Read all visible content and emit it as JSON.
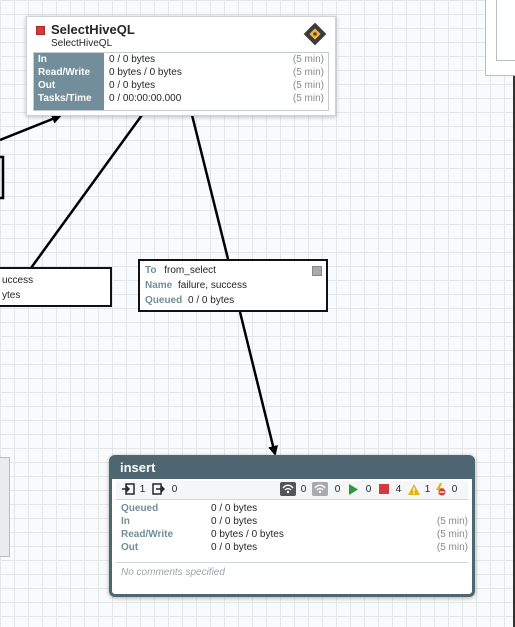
{
  "processor": {
    "name": "SelectHiveQL",
    "type": "SelectHiveQL",
    "stats": [
      {
        "label": "In",
        "value": "0 / 0 bytes",
        "period": "(5 min)"
      },
      {
        "label": "Read/Write",
        "value": "0 bytes / 0 bytes",
        "period": "(5 min)"
      },
      {
        "label": "Out",
        "value": "0 / 0 bytes",
        "period": "(5 min)"
      },
      {
        "label": "Tasks/Time",
        "value": "0 / 00:00:00.000",
        "period": "(5 min)"
      }
    ]
  },
  "connection_left": {
    "name_partial": "uccess",
    "queued_partial": "ytes"
  },
  "connection_main": {
    "to_label": "To",
    "to_value": "from_select",
    "name_label": "Name",
    "name_value": "failure, success",
    "queued_label": "Queued",
    "queued_value": "0 / 0 bytes"
  },
  "process_group": {
    "name": "insert",
    "input_ports": "1",
    "output_ports": "0",
    "transmitting": "0",
    "not_transmitting": "0",
    "running": "0",
    "stopped": "4",
    "invalid": "1",
    "disabled": "0",
    "stats": [
      {
        "label": "Queued",
        "value": "0 / 0 bytes",
        "period": ""
      },
      {
        "label": "In",
        "value": "0 / 0 bytes",
        "period": "(5 min)"
      },
      {
        "label": "Read/Write",
        "value": "0 bytes / 0 bytes",
        "period": "(5 min)"
      },
      {
        "label": "Out",
        "value": "0 / 0 bytes",
        "period": "(5 min)"
      }
    ],
    "comments": "No comments specified"
  },
  "colors": {
    "accent": "#728e9b",
    "group_header": "#4e6671",
    "stopped": "#d33a3a",
    "running": "#2e9b3a",
    "invalid": "#e2b21b"
  }
}
